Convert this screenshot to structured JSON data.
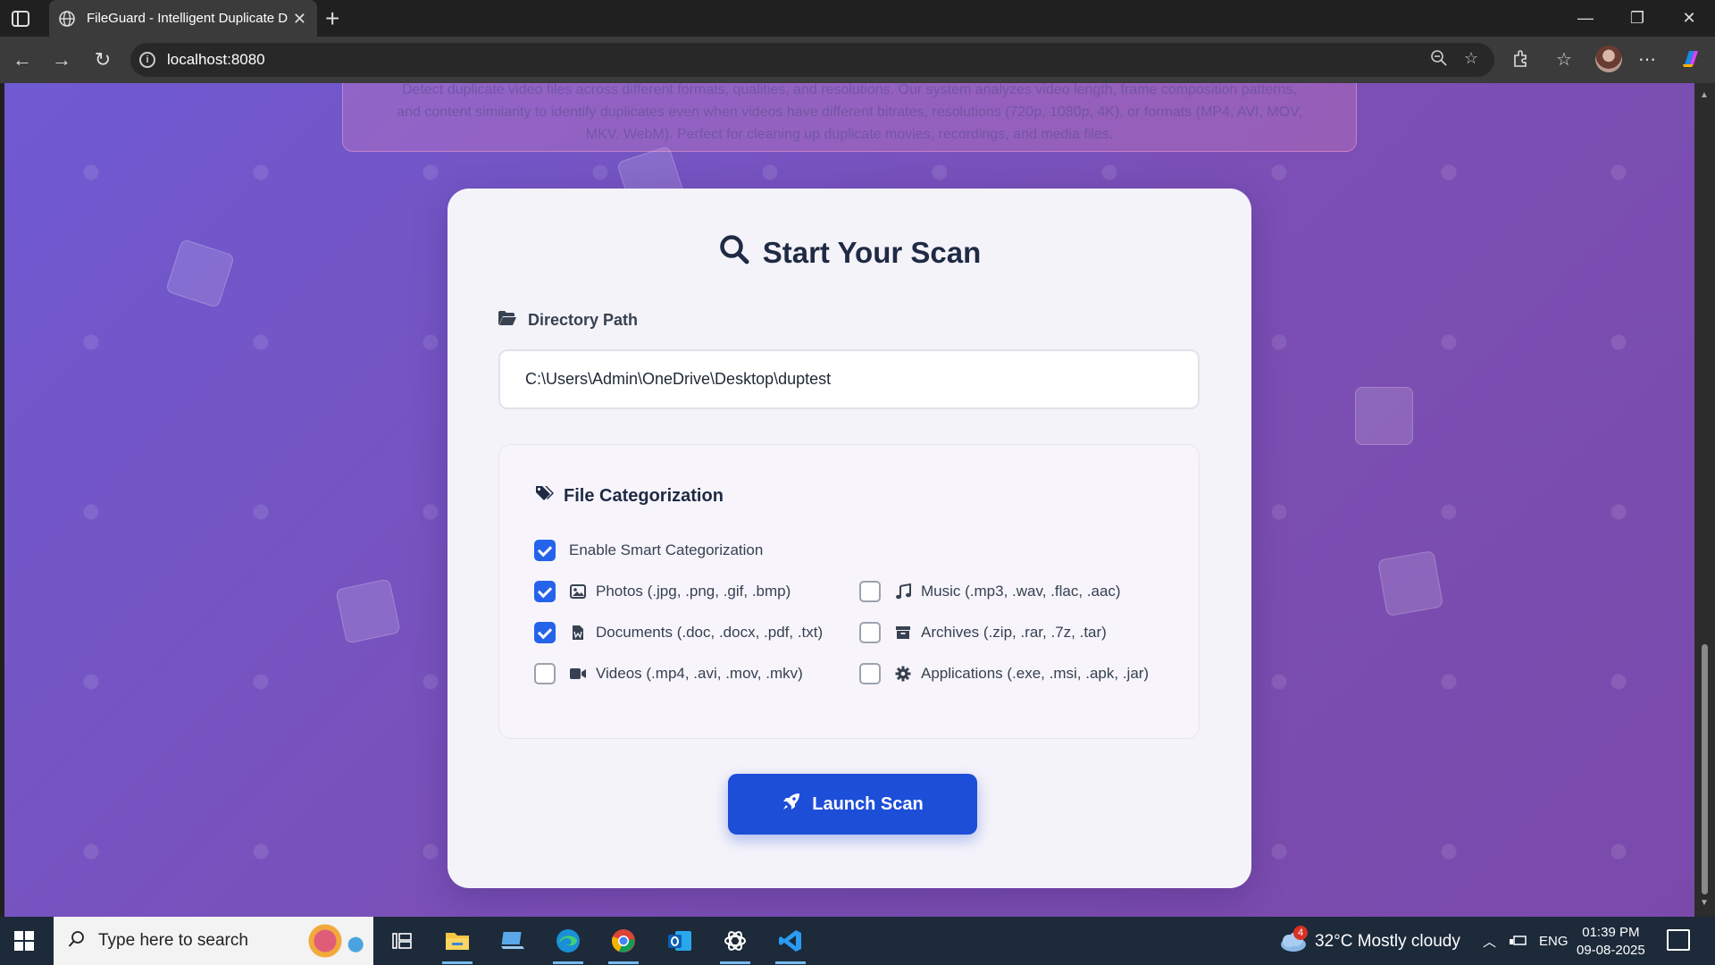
{
  "browser": {
    "tab_title": "FileGuard - Intelligent Duplicate D",
    "url": "localhost:8080"
  },
  "banner": {
    "line1": "Detect duplicate video files across different formats, qualities, and resolutions. Our system analyzes video length, frame composition patterns,",
    "line2": "and content similarity to identify duplicates even when videos have different bitrates, resolutions (720p, 1080p, 4K), or formats (MP4, AVI, MOV,",
    "line3": "MKV, WebM). Perfect for cleaning up duplicate movies, recordings, and media files."
  },
  "scan": {
    "title": "Start Your Scan",
    "directory_label": "Directory Path",
    "directory_value": "C:\\Users\\Admin\\OneDrive\\Desktop\\duptest",
    "categorization": {
      "heading": "File Categorization",
      "enable_label": "Enable Smart Categorization",
      "enable_checked": true,
      "options": [
        {
          "label": "Photos (.jpg, .png, .gif, .bmp)",
          "checked": true,
          "icon": "image-icon"
        },
        {
          "label": "Music (.mp3, .wav, .flac, .aac)",
          "checked": false,
          "icon": "music-icon"
        },
        {
          "label": "Documents (.doc, .docx, .pdf, .txt)",
          "checked": true,
          "icon": "document-icon"
        },
        {
          "label": "Archives (.zip, .rar, .7z, .tar)",
          "checked": false,
          "icon": "archive-icon"
        },
        {
          "label": "Videos (.mp4, .avi, .mov, .mkv)",
          "checked": false,
          "icon": "video-icon"
        },
        {
          "label": "Applications (.exe, .msi, .apk, .jar)",
          "checked": false,
          "icon": "gear-icon"
        }
      ]
    },
    "launch_label": "Launch Scan"
  },
  "taskbar": {
    "search_placeholder": "Type here to search",
    "weather_badge": "4",
    "weather": "32°C  Mostly cloudy",
    "lang": "ENG",
    "time": "01:39 PM",
    "date": "09-08-2025"
  },
  "colors": {
    "accent": "#1d4ed8",
    "checkbox": "#2563eb",
    "background_start": "#6f5ad2",
    "background_end": "#7a4aab"
  }
}
